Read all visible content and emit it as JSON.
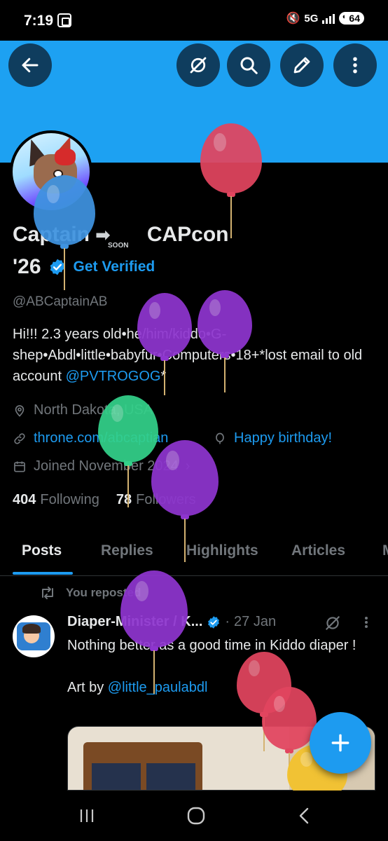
{
  "status_bar": {
    "time": "7:19",
    "network": "5G",
    "battery": "64"
  },
  "header": {
    "back_label": "Back",
    "grok_label": "Grok",
    "search_label": "Search",
    "edit_label": "Edit",
    "more_label": "More"
  },
  "profile": {
    "name_part1": "Captain",
    "arrow": "➡",
    "soon_badge": "SOON",
    "name_part2": "CAPcon",
    "name_year": "'26",
    "get_verified": "Get Verified",
    "handle": "@ABCaptainAB",
    "bio_text": "Hi!!! 2.3 years old•he/him/kiddo•G-shep•Abdl•little•babyfur•Computers•18+*lost email to old account ",
    "bio_mention": "@PVTROGOG",
    "bio_end": "*",
    "location": "North Dakota, USA",
    "website": "throne.com/abcaptian",
    "birthday": "Happy birthday!",
    "joined": "Joined November 2024",
    "following_count": "404",
    "following_label": "Following",
    "followers_count": "78",
    "followers_label": "Followers"
  },
  "tabs": [
    "Posts",
    "Replies",
    "Highlights",
    "Articles",
    "Media"
  ],
  "post": {
    "reposted_label": "You reposted",
    "author": "Diaper-Minister / K...",
    "dot": "·",
    "date": "27 Jan",
    "text_line": "Nothing better as a good time in Kiddo diaper !",
    "art_by": "Art by ",
    "art_mention": "@little_paulabdl"
  },
  "fab_label": "New post",
  "colors": {
    "banner": "#1da1f2",
    "accent": "#1d9bf0",
    "icon_button_bg": "#0f3d5e",
    "balloon_red": "#e2455f",
    "balloon_blue": "#3f93e0",
    "balloon_purple": "#8e35cf",
    "balloon_green": "#33d18a",
    "balloon_yellow": "#f4c22b"
  }
}
